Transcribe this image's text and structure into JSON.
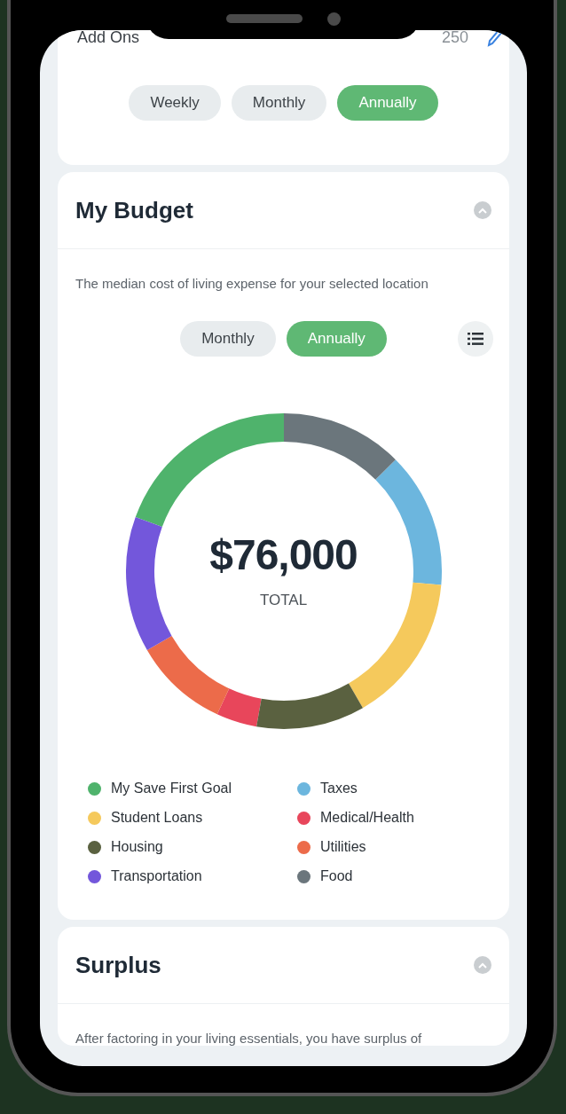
{
  "add_ons_row": {
    "label": "Add Ons",
    "value": "250"
  },
  "period_tabs": [
    {
      "label": "Weekly",
      "selected": false
    },
    {
      "label": "Monthly",
      "selected": false
    },
    {
      "label": "Annually",
      "selected": true
    }
  ],
  "budget": {
    "title": "My Budget",
    "expanded": true,
    "description": "The median cost of living expense for your selected location",
    "period_tabs": [
      {
        "label": "Monthly",
        "selected": false
      },
      {
        "label": "Annually",
        "selected": true
      }
    ],
    "total": "$76,000",
    "total_label": "TOTAL",
    "legend": [
      {
        "label": "My Save First Goal",
        "color": "#4fb36c"
      },
      {
        "label": "Taxes",
        "color": "#6cb6de"
      },
      {
        "label": "Student Loans",
        "color": "#f5c95c"
      },
      {
        "label": "Medical/Health",
        "color": "#e8465b"
      },
      {
        "label": "Housing",
        "color": "#5a6140"
      },
      {
        "label": "Utilities",
        "color": "#ec6b4a"
      },
      {
        "label": "Transportation",
        "color": "#7357db"
      },
      {
        "label": "Food",
        "color": "#6b767c"
      }
    ]
  },
  "surplus": {
    "title": "Surplus",
    "expanded": true,
    "description": "After factoring in your living essentials, you have surplus of"
  }
}
